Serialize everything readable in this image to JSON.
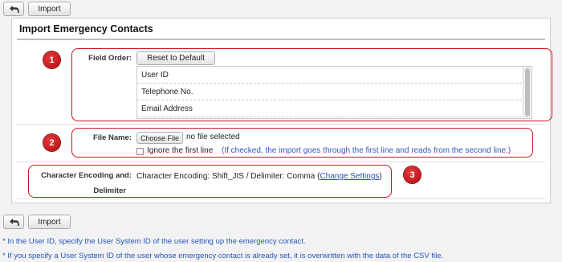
{
  "toolbar": {
    "import_label": "Import"
  },
  "panel": {
    "title": "Import Emergency Contacts"
  },
  "field_order": {
    "label": "Field Order:",
    "reset_label": "Reset to Default",
    "items": [
      "User ID",
      "Telephone No.",
      "Email Address"
    ]
  },
  "file": {
    "label": "File Name:",
    "choose_label": "Choose File",
    "status": "no file selected",
    "ignore_label": "Ignore the first line",
    "ignore_hint": "(If checked, the import goes through the first line and reads from the second line.)"
  },
  "encoding": {
    "label_line1": "Character Encoding and:",
    "label_line2": "Delimiter",
    "value": "Character Encoding: Shift_JIS / Delimiter: Comma",
    "link_open": "(",
    "link_label": "Change Settings",
    "link_close": ")"
  },
  "callouts": {
    "one": "1",
    "two": "2",
    "three": "3"
  },
  "notes": [
    "* In the User ID, specify the User System ID of the user setting up the emergency contact.",
    "* If you specify a User System ID of the user whose emergency contact is already set, it is overwritten with the data of the CSV file."
  ],
  "colors": {
    "highlight": "#c8151c",
    "link": "#2a4fb0",
    "note": "#2255bb"
  },
  "icons": {
    "back": "back-arrow-icon"
  }
}
